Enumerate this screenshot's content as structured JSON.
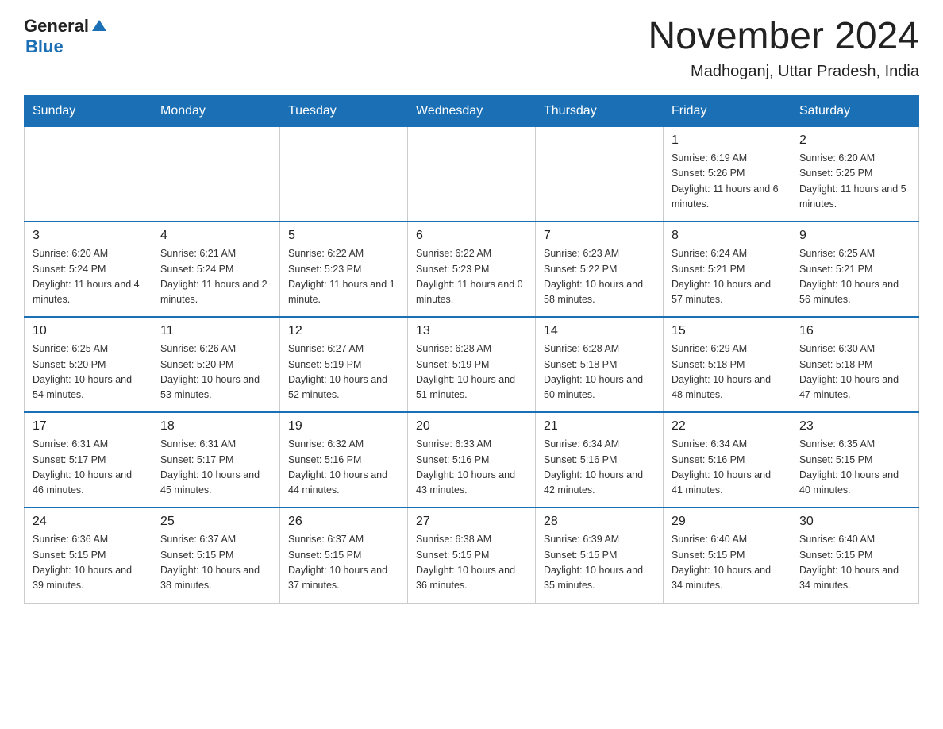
{
  "header": {
    "logo_general": "General",
    "logo_blue": "Blue",
    "title": "November 2024",
    "subtitle": "Madhoganj, Uttar Pradesh, India"
  },
  "weekdays": [
    "Sunday",
    "Monday",
    "Tuesday",
    "Wednesday",
    "Thursday",
    "Friday",
    "Saturday"
  ],
  "weeks": [
    [
      {
        "day": "",
        "info": ""
      },
      {
        "day": "",
        "info": ""
      },
      {
        "day": "",
        "info": ""
      },
      {
        "day": "",
        "info": ""
      },
      {
        "day": "",
        "info": ""
      },
      {
        "day": "1",
        "info": "Sunrise: 6:19 AM\nSunset: 5:26 PM\nDaylight: 11 hours and 6 minutes."
      },
      {
        "day": "2",
        "info": "Sunrise: 6:20 AM\nSunset: 5:25 PM\nDaylight: 11 hours and 5 minutes."
      }
    ],
    [
      {
        "day": "3",
        "info": "Sunrise: 6:20 AM\nSunset: 5:24 PM\nDaylight: 11 hours and 4 minutes."
      },
      {
        "day": "4",
        "info": "Sunrise: 6:21 AM\nSunset: 5:24 PM\nDaylight: 11 hours and 2 minutes."
      },
      {
        "day": "5",
        "info": "Sunrise: 6:22 AM\nSunset: 5:23 PM\nDaylight: 11 hours and 1 minute."
      },
      {
        "day": "6",
        "info": "Sunrise: 6:22 AM\nSunset: 5:23 PM\nDaylight: 11 hours and 0 minutes."
      },
      {
        "day": "7",
        "info": "Sunrise: 6:23 AM\nSunset: 5:22 PM\nDaylight: 10 hours and 58 minutes."
      },
      {
        "day": "8",
        "info": "Sunrise: 6:24 AM\nSunset: 5:21 PM\nDaylight: 10 hours and 57 minutes."
      },
      {
        "day": "9",
        "info": "Sunrise: 6:25 AM\nSunset: 5:21 PM\nDaylight: 10 hours and 56 minutes."
      }
    ],
    [
      {
        "day": "10",
        "info": "Sunrise: 6:25 AM\nSunset: 5:20 PM\nDaylight: 10 hours and 54 minutes."
      },
      {
        "day": "11",
        "info": "Sunrise: 6:26 AM\nSunset: 5:20 PM\nDaylight: 10 hours and 53 minutes."
      },
      {
        "day": "12",
        "info": "Sunrise: 6:27 AM\nSunset: 5:19 PM\nDaylight: 10 hours and 52 minutes."
      },
      {
        "day": "13",
        "info": "Sunrise: 6:28 AM\nSunset: 5:19 PM\nDaylight: 10 hours and 51 minutes."
      },
      {
        "day": "14",
        "info": "Sunrise: 6:28 AM\nSunset: 5:18 PM\nDaylight: 10 hours and 50 minutes."
      },
      {
        "day": "15",
        "info": "Sunrise: 6:29 AM\nSunset: 5:18 PM\nDaylight: 10 hours and 48 minutes."
      },
      {
        "day": "16",
        "info": "Sunrise: 6:30 AM\nSunset: 5:18 PM\nDaylight: 10 hours and 47 minutes."
      }
    ],
    [
      {
        "day": "17",
        "info": "Sunrise: 6:31 AM\nSunset: 5:17 PM\nDaylight: 10 hours and 46 minutes."
      },
      {
        "day": "18",
        "info": "Sunrise: 6:31 AM\nSunset: 5:17 PM\nDaylight: 10 hours and 45 minutes."
      },
      {
        "day": "19",
        "info": "Sunrise: 6:32 AM\nSunset: 5:16 PM\nDaylight: 10 hours and 44 minutes."
      },
      {
        "day": "20",
        "info": "Sunrise: 6:33 AM\nSunset: 5:16 PM\nDaylight: 10 hours and 43 minutes."
      },
      {
        "day": "21",
        "info": "Sunrise: 6:34 AM\nSunset: 5:16 PM\nDaylight: 10 hours and 42 minutes."
      },
      {
        "day": "22",
        "info": "Sunrise: 6:34 AM\nSunset: 5:16 PM\nDaylight: 10 hours and 41 minutes."
      },
      {
        "day": "23",
        "info": "Sunrise: 6:35 AM\nSunset: 5:15 PM\nDaylight: 10 hours and 40 minutes."
      }
    ],
    [
      {
        "day": "24",
        "info": "Sunrise: 6:36 AM\nSunset: 5:15 PM\nDaylight: 10 hours and 39 minutes."
      },
      {
        "day": "25",
        "info": "Sunrise: 6:37 AM\nSunset: 5:15 PM\nDaylight: 10 hours and 38 minutes."
      },
      {
        "day": "26",
        "info": "Sunrise: 6:37 AM\nSunset: 5:15 PM\nDaylight: 10 hours and 37 minutes."
      },
      {
        "day": "27",
        "info": "Sunrise: 6:38 AM\nSunset: 5:15 PM\nDaylight: 10 hours and 36 minutes."
      },
      {
        "day": "28",
        "info": "Sunrise: 6:39 AM\nSunset: 5:15 PM\nDaylight: 10 hours and 35 minutes."
      },
      {
        "day": "29",
        "info": "Sunrise: 6:40 AM\nSunset: 5:15 PM\nDaylight: 10 hours and 34 minutes."
      },
      {
        "day": "30",
        "info": "Sunrise: 6:40 AM\nSunset: 5:15 PM\nDaylight: 10 hours and 34 minutes."
      }
    ]
  ]
}
